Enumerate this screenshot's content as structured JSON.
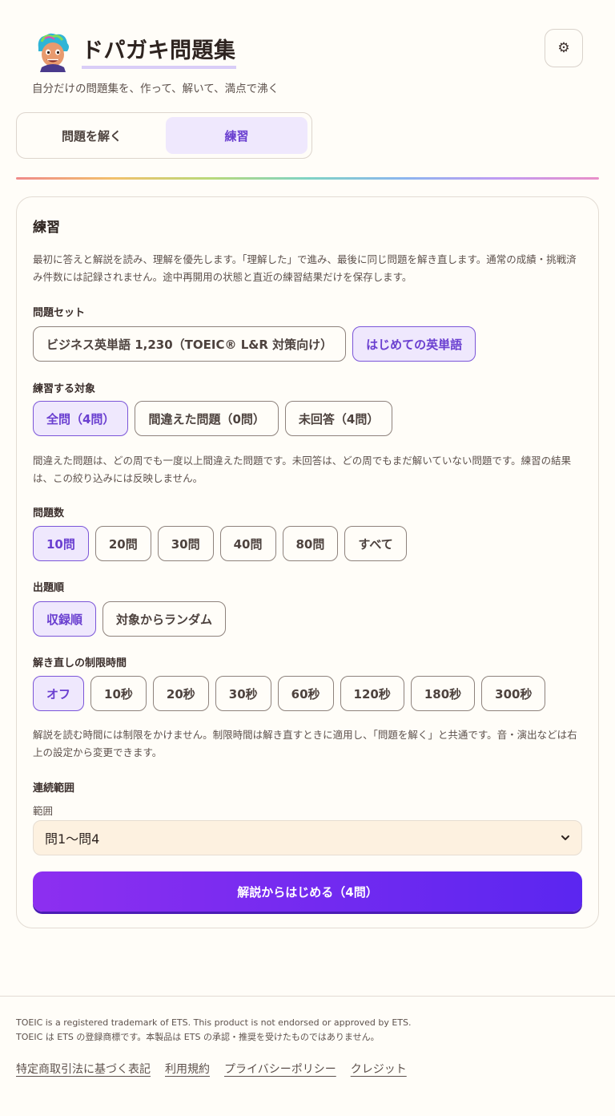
{
  "app": {
    "title": "ドパガキ問題集",
    "subtitle": "自分だけの問題集を、作って、解いて、満点で沸く",
    "settings_icon": "⚙"
  },
  "tabs": [
    {
      "label": "問題を解く",
      "active": false
    },
    {
      "label": "練習",
      "active": true
    }
  ],
  "practice": {
    "title": "練習",
    "description": "最初に答えと解説を読み、理解を優先します。「理解した」で進み、最後に同じ問題を解き直します。通常の成績・挑戦済み件数には記録されません。途中再開用の状態と直近の練習結果だけを保存します。",
    "set_label": "問題セット",
    "sets": [
      "ビジネス英単語 1,230（TOEIC® L&R 対策向け）",
      "はじめての英単語"
    ],
    "target_label": "練習する対象",
    "targets": [
      "全問（4問）",
      "間違えた問題（0問）",
      "未回答（4問）"
    ],
    "target_note": "間違えた問題は、どの周でも一度以上間違えた問題です。未回答は、どの周でもまだ解いていない問題です。練習の結果は、この絞り込みには反映しません。",
    "count_label": "問題数",
    "counts": [
      "10問",
      "20問",
      "30問",
      "40問",
      "80問",
      "すべて"
    ],
    "order_label": "出題順",
    "orders": [
      "収録順",
      "対象からランダム"
    ],
    "time_label": "解き直しの制限時間",
    "times": [
      "オフ",
      "10秒",
      "20秒",
      "30秒",
      "60秒",
      "120秒",
      "180秒",
      "300秒"
    ],
    "time_note": "解説を読む時間には制限をかけません。制限時間は解き直すときに適用し、「問題を解く」と共通です。音・演出などは右上の設定から変更できます。",
    "range_label": "連続範囲",
    "range_field_label": "範囲",
    "range_value": "問1〜問4",
    "start_button": "解説からはじめる（4問）"
  },
  "footer": {
    "trademark_en": "TOEIC is a registered trademark of ETS. This product is not endorsed or approved by ETS.",
    "trademark_ja": "TOEIC は ETS の登録商標です。本製品は ETS の承認・推奨を受けたものではありません。",
    "links": [
      "特定商取引法に基づく表記",
      "利用規約",
      "プライバシーポリシー",
      "クレジット"
    ]
  }
}
